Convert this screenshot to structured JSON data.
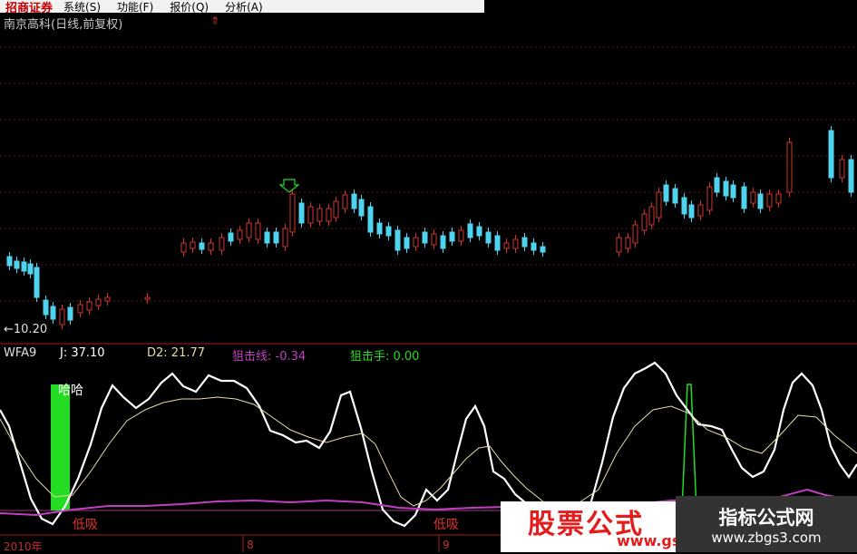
{
  "menubar": {
    "brand": "招商证券",
    "items": [
      "系统(S)",
      "功能(F)",
      "报价(Q)",
      "分析(A)"
    ]
  },
  "chart": {
    "title": "南京高科(日线,前复权)",
    "low_price_label": "←10.20"
  },
  "indicator": {
    "name": "WFA9",
    "j": "J: 37.10",
    "d2": "D2: 21.77",
    "line1": "狙击线: -0.34",
    "line2": "狙击手: 0.00",
    "haha": "哈哈",
    "signal": "低吸"
  },
  "axis": {
    "labels": [
      "2010年",
      "8",
      "9"
    ]
  },
  "watermarks": {
    "left_main": "股票公式",
    "left_sub": "www.gsz",
    "right_main": "指标公式网",
    "right_sub": "www.zbgs3.com"
  },
  "colors": {
    "up": "#d0352e",
    "down": "#4fd4ef",
    "j_line": "#ffffff",
    "d_line": "#e8dca8",
    "purple": "#c040c0",
    "signal_green": "#22dd22",
    "axis_red": "#a02020"
  }
}
